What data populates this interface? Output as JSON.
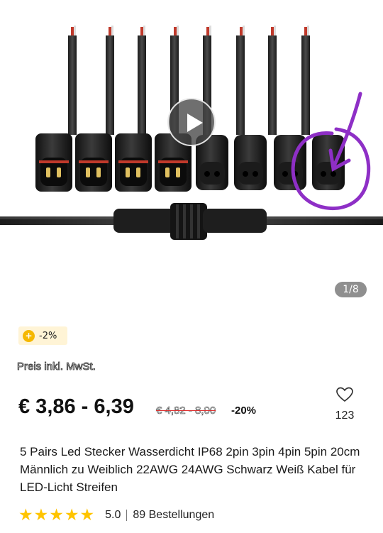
{
  "gallery": {
    "counter": "1/8",
    "play_icon": "play-icon"
  },
  "coupon": {
    "icon": "coin-icon",
    "icon_glyph": "+",
    "text": "-2%"
  },
  "vat_label": "Preis inkl. MwSt.",
  "price": {
    "current": "€ 3,86 - 6,39",
    "original": "€ 4,82 - 8,00",
    "discount": "-20%"
  },
  "wishlist": {
    "icon": "heart-icon",
    "count": "123"
  },
  "product_title": "5 Pairs Led Stecker Wasserdicht IP68 2pin 3pin 4pin 5pin 20cm Männlich zu Weiblich 22AWG 24AWG Schwarz Weiß Kabel für LED-Licht Streifen",
  "rating": {
    "stars": 5,
    "score": "5.0",
    "orders": "89 Bestellungen"
  },
  "colors": {
    "star": "#ffc400",
    "annotation": "#8e2fc6",
    "coupon_bg": "#fff4d6"
  }
}
